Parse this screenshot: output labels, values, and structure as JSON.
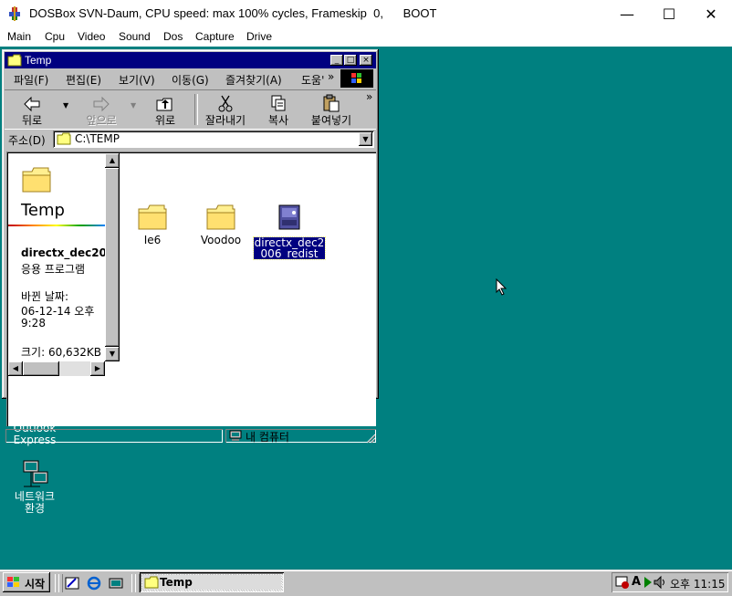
{
  "host": {
    "title": "DOSBox SVN-Daum, CPU speed: max 100% cycles, Frameskip  0,      BOOT",
    "minimize": "—",
    "maximize": "☐",
    "close": "✕",
    "menu": [
      "Main",
      "Cpu",
      "Video",
      "Sound",
      "Dos",
      "Capture",
      "Drive"
    ]
  },
  "explorer": {
    "title": "Temp",
    "menu": [
      "파일(F)",
      "편집(E)",
      "보기(V)",
      "이동(G)",
      "즐겨찾기(A)",
      "도움'",
      "»"
    ],
    "toolbar": {
      "back": "뒤로",
      "forward": "앞으로",
      "up": "위로",
      "cut": "잘라내기",
      "copy": "복사",
      "paste": "붙여넣기",
      "more": "»"
    },
    "address": {
      "label": "주소(D)",
      "value": "C:\\TEMP"
    },
    "info": {
      "folder_name": "Temp",
      "file_name": "directx_dec20",
      "file_type": "응용 프로그램",
      "modified_label": "바뀐 날짜:",
      "modified_date": "06-12-14 오후",
      "modified_time": "9:28",
      "size": "크기: 60,632KB"
    },
    "files": [
      {
        "label": "Ie6",
        "icon": "folder-icon"
      },
      {
        "label": "Voodoo",
        "icon": "folder-icon"
      },
      {
        "label_line1": "directx_dec2",
        "label_line2": "006_redist",
        "icon": "installer-icon",
        "selected": true
      }
    ],
    "status": {
      "zone": "내 컴퓨터"
    }
  },
  "desktop": {
    "icons": [
      {
        "line1": "Outlook",
        "line2": "Express",
        "icon": "outlook-express-icon"
      },
      {
        "line1": "네트워크",
        "line2": "환경",
        "icon": "network-neighborhood-icon"
      }
    ]
  },
  "taskbar": {
    "start": "시작",
    "task": "Temp",
    "clock": "오후 11:15"
  },
  "colors": {
    "desktop": "#008080",
    "title_active": "#000080",
    "face": "#c0c0c0"
  }
}
